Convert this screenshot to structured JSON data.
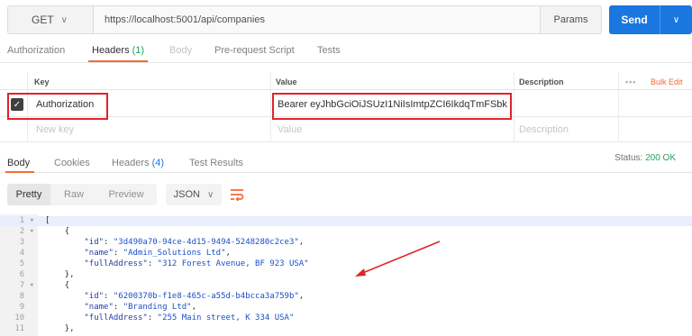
{
  "request": {
    "method": "GET",
    "url": "https://localhost:5001/api/companies",
    "params_label": "Params",
    "send_label": "Send"
  },
  "request_tabs": [
    {
      "label": "Authorization"
    },
    {
      "label": "Headers",
      "count": "(1)"
    },
    {
      "label": "Body"
    },
    {
      "label": "Pre-request Script"
    },
    {
      "label": "Tests"
    }
  ],
  "headers_table": {
    "columns": {
      "key": "Key",
      "value": "Value",
      "description": "Description"
    },
    "more_label": "•••",
    "bulk_edit_label": "Bulk Edit",
    "rows": [
      {
        "key": "Authorization",
        "value": "Bearer eyJhbGciOiJSUzI1NiIsImtpZCI6IkdqTmFSbk0...",
        "description": "",
        "checked": true
      }
    ],
    "new_row": {
      "key_placeholder": "New key",
      "value_placeholder": "Value",
      "description_placeholder": "Description"
    }
  },
  "response_tabs": [
    {
      "label": "Body"
    },
    {
      "label": "Cookies"
    },
    {
      "label": "Headers",
      "count": "(4)"
    },
    {
      "label": "Test Results"
    }
  ],
  "status": {
    "label": "Status:",
    "value": "200 OK"
  },
  "view_modes": {
    "pretty": "Pretty",
    "raw": "Raw",
    "preview": "Preview",
    "format": "JSON"
  },
  "code_lines": [
    {
      "n": "1",
      "fold": true,
      "text": "["
    },
    {
      "n": "2",
      "fold": true,
      "text": "    {"
    },
    {
      "n": "3",
      "text": "        \"id\": \"3d490a70-94ce-4d15-9494-5248280c2ce3\","
    },
    {
      "n": "4",
      "text": "        \"name\": \"Admin_Solutions Ltd\","
    },
    {
      "n": "5",
      "text": "        \"fullAddress\": \"312 Forest Avenue, BF 923 USA\""
    },
    {
      "n": "6",
      "text": "    },"
    },
    {
      "n": "7",
      "fold": true,
      "text": "    {"
    },
    {
      "n": "8",
      "text": "        \"id\": \"6200370b-f1e8-465c-a55d-b4bcca3a759b\","
    },
    {
      "n": "9",
      "text": "        \"name\": \"Branding Ltd\","
    },
    {
      "n": "10",
      "text": "        \"fullAddress\": \"255 Main street, K 334 USA\""
    },
    {
      "n": "11",
      "text": "    },"
    }
  ],
  "colors": {
    "accent": "#f26b3a",
    "send": "#1a77e0",
    "annotation": "#e0242a",
    "success": "#27a05f"
  }
}
